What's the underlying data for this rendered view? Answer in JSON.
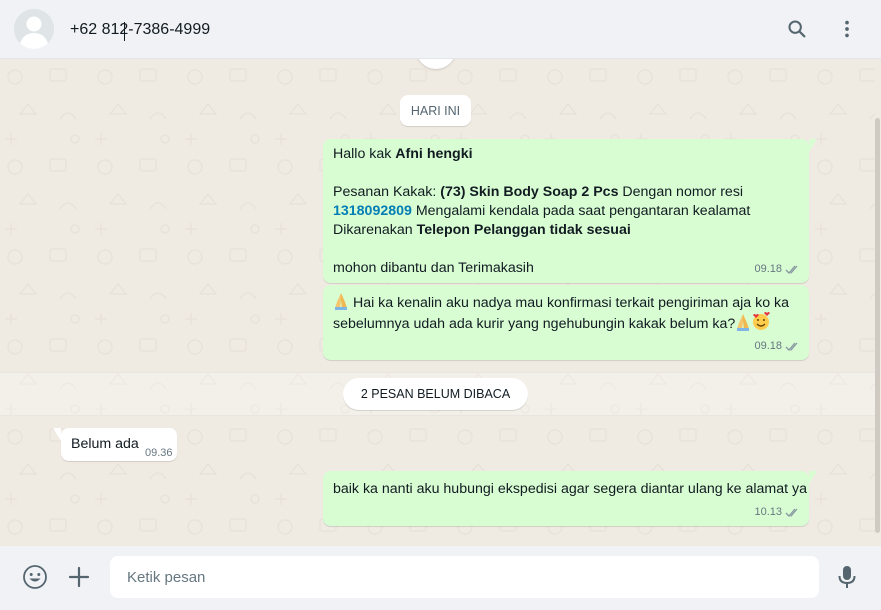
{
  "header": {
    "contact_name": "+62 812-7386-4999",
    "icons": {
      "avatar": "default-avatar",
      "search": "search-icon",
      "menu": "kebab-menu-icon"
    }
  },
  "chat": {
    "date_divider": "HARI INI",
    "messages": [
      {
        "direction": "outgoing",
        "greeting_prefix": "Hallo kak ",
        "greeting_name": "Afni hengki",
        "order_prefix": "Pesanan Kakak: ",
        "order_item": "(73) Skin Body Soap 2 Pcs",
        "order_mid": " Dengan nomor resi",
        "resi": "1318092809",
        "resi_suffix": " Mengalami kendala pada saat pengantaran kealamat",
        "reason_prefix": "Dikarenakan ",
        "reason": "Telepon Pelanggan tidak sesuai",
        "closing": " mohon dibantu dan Terimakasih",
        "time": "09.18",
        "status": "delivered"
      },
      {
        "direction": "outgoing",
        "line1": " Hai ka kenalin aku nadya mau konfirmasi terkait pengiriman aja ko ka",
        "line2": "sebelumnya udah ada kurir yang ngehubungin kakak belum ka?",
        "emoji": [
          "folded-hands",
          "folded-hands",
          "smiling-face-with-hearts"
        ],
        "time": "09.18",
        "status": "delivered"
      },
      {
        "direction": "incoming",
        "text": "Belum ada",
        "time": "09.36"
      },
      {
        "direction": "outgoing",
        "text": "baik ka nanti aku hubungi ekspedisi agar segera diantar ulang ke alamat ya",
        "time": "10.13",
        "status": "delivered"
      }
    ],
    "unread_divider": "2 PESAN BELUM DIBACA"
  },
  "composer": {
    "placeholder": "Ketik pesan",
    "value": "",
    "icons": {
      "emoji": "emoji-icon",
      "attach": "plus-icon",
      "voice": "microphone-icon"
    }
  },
  "colors": {
    "outgoing_bubble": "#d9fdd3",
    "incoming_bubble": "#ffffff",
    "chat_background": "#efeae2",
    "header_background": "#f0f2f5",
    "link": "#027eb5",
    "meta_text": "#667781"
  }
}
